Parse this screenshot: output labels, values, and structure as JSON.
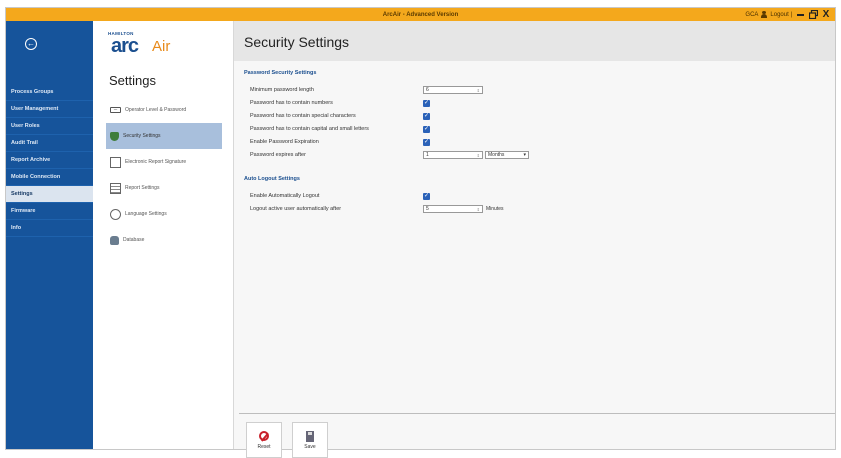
{
  "window": {
    "title": "ArcAir - Advanced Version",
    "user": "GCA",
    "logout_label": "Logout |",
    "close_glyph": "X"
  },
  "sidebar": {
    "items": [
      {
        "label": "Process Groups"
      },
      {
        "label": "User Management"
      },
      {
        "label": "User Roles"
      },
      {
        "label": "Audit Trail"
      },
      {
        "label": "Report Archive"
      },
      {
        "label": "Mobile Connection"
      },
      {
        "label": "Settings",
        "active": true
      },
      {
        "label": "Firmware"
      },
      {
        "label": "Info"
      }
    ]
  },
  "logo": {
    "top": "HAMILTON",
    "arc": "arc",
    "air": "Air"
  },
  "settings_menu": {
    "title": "Settings",
    "items": [
      {
        "label": "Operator Level & Password",
        "icon": "password-icon"
      },
      {
        "label": "Security Settings",
        "icon": "shield-icon",
        "active": true
      },
      {
        "label": "Electronic Report Signature",
        "icon": "signature-icon"
      },
      {
        "label": "Report Settings",
        "icon": "report-icon"
      },
      {
        "label": "Language Settings",
        "icon": "language-icon"
      },
      {
        "label": "Database",
        "icon": "database-icon"
      }
    ],
    "pwd_glyph": "***"
  },
  "main": {
    "title": "Security Settings",
    "password_section": {
      "title": "Password Security Settings",
      "min_length_label": "Minimum password length",
      "min_length_value": "6",
      "numbers_label": "Password has to contain numbers",
      "special_label": "Password has to contain special characters",
      "case_label": "Password has to contain capital and small letters",
      "expiration_label": "Enable Password Expiration",
      "expires_label": "Password expires after",
      "expires_value": "1",
      "expires_unit": "Months"
    },
    "logout_section": {
      "title": "Auto Logout Settings",
      "enable_label": "Enable Automatically Logout",
      "after_label": "Logout active user automatically after",
      "after_value": "5",
      "after_unit": "Minutes"
    },
    "checked": true
  },
  "footer": {
    "reset_label": "Reset",
    "save_label": "Save"
  },
  "colors": {
    "titlebar": "#f4a81c",
    "sidebar": "#16549b",
    "accent": "#1b4f8f",
    "checkbox": "#2b62b8"
  },
  "glyphs": {
    "back": "←",
    "check": "✓",
    "spin": "⇕",
    "dropdown": "▾"
  }
}
